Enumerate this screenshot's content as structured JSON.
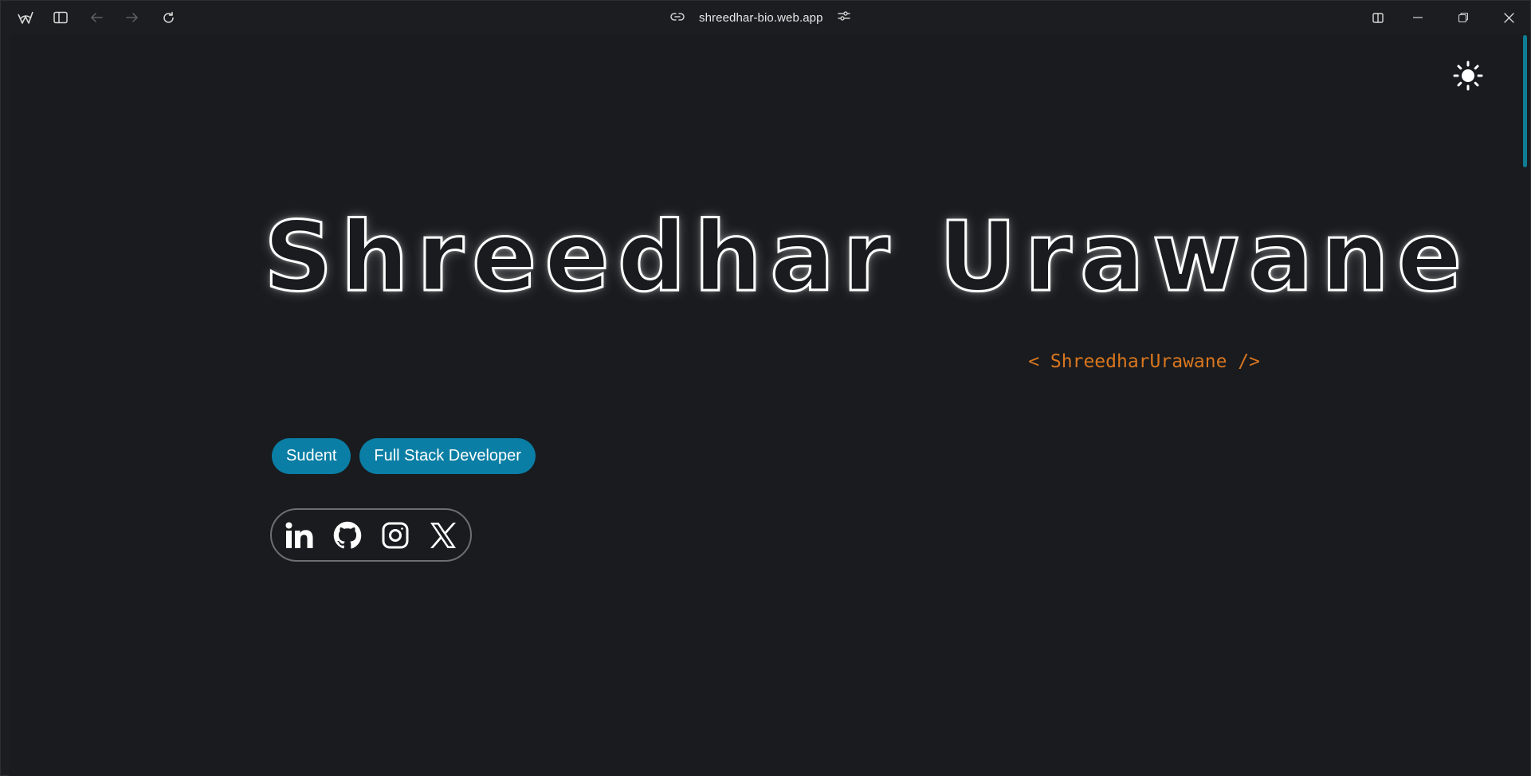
{
  "browser": {
    "url": "shreedhar-bio.web.app",
    "icons": {
      "app": "app-logo-icon",
      "sidebar": "sidebar-toggle-icon",
      "back": "back-arrow-icon",
      "forward": "forward-arrow-icon",
      "reload": "reload-icon",
      "link": "link-icon",
      "site_settings": "sliders-icon",
      "split": "split-view-icon",
      "minimize": "minimize-icon",
      "restore": "restore-icon",
      "close": "close-icon"
    }
  },
  "page": {
    "name": "Shreedhar Urawane",
    "handle": "< ShreedharUrawane />",
    "theme_icon": "sun-icon",
    "tags": [
      {
        "label": "Sudent"
      },
      {
        "label": "Full Stack Developer"
      }
    ],
    "socials": [
      {
        "icon": "linkedin-icon"
      },
      {
        "icon": "github-icon"
      },
      {
        "icon": "instagram-icon"
      },
      {
        "icon": "x-icon"
      }
    ]
  },
  "colors": {
    "background": "#191b1e",
    "accent_tag": "#0a7ea4",
    "handle": "#d9761e",
    "scrollbar": "#0e7d92"
  }
}
